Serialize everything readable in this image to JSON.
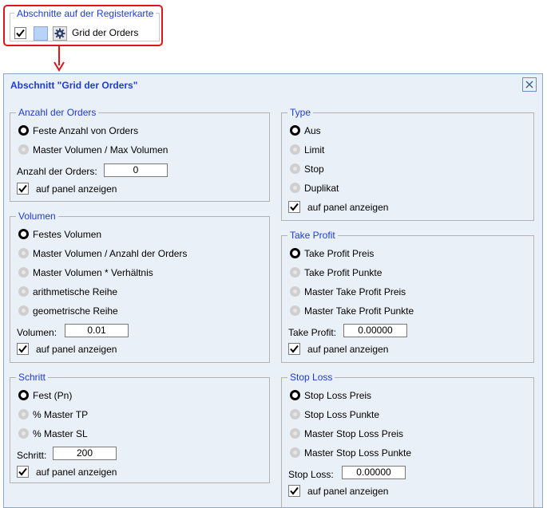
{
  "header": {
    "group_label": "Abschnitte auf der Registerkarte",
    "section_label": "Grid der Orders"
  },
  "panel": {
    "title": "Abschnitt \"Grid der Orders\"",
    "anzahl": {
      "legend": "Anzahl der Orders",
      "options": [
        "Feste Anzahl von Orders",
        "Master Volumen / Max Volumen"
      ],
      "selected": 0,
      "field_label": "Anzahl der Orders:",
      "field_value": "0",
      "show_label": "auf panel anzeigen"
    },
    "volumen": {
      "legend": "Volumen",
      "options": [
        "Festes Volumen",
        "Master Volumen / Anzahl der Orders",
        "Master Volumen * Verhältnis",
        "arithmetische Reihe",
        "geometrische Reihe"
      ],
      "selected": 0,
      "field_label": "Volumen:",
      "field_value": "0.01",
      "show_label": "auf panel anzeigen"
    },
    "schritt": {
      "legend": "Schritt",
      "options": [
        "Fest (Pn)",
        "% Master TP",
        "% Master SL"
      ],
      "selected": 0,
      "field_label": "Schritt:",
      "field_value": "200",
      "show_label": "auf panel anzeigen"
    },
    "type": {
      "legend": "Type",
      "options": [
        "Aus",
        "Limit",
        "Stop",
        "Duplikat"
      ],
      "selected": 0,
      "show_label": "auf panel anzeigen"
    },
    "takeprofit": {
      "legend": "Take Profit",
      "options": [
        "Take Profit Preis",
        "Take Profit Punkte",
        "Master Take Profit Preis",
        "Master Take Profit Punkte"
      ],
      "selected": 0,
      "field_label": "Take Profit:",
      "field_value": "0.00000",
      "show_label": "auf panel anzeigen"
    },
    "stoploss": {
      "legend": "Stop Loss",
      "options": [
        "Stop Loss Preis",
        "Stop Loss Punkte",
        "Master Stop Loss Preis",
        "Master Stop Loss Punkte"
      ],
      "selected": 0,
      "field_label": "Stop Loss:",
      "field_value": "0.00000",
      "show_label": "auf panel anzeigen"
    }
  },
  "colors": {
    "accent": "#1f3bd6",
    "highlight": "#e0141c",
    "panel_bg": "#e9f0f7"
  }
}
